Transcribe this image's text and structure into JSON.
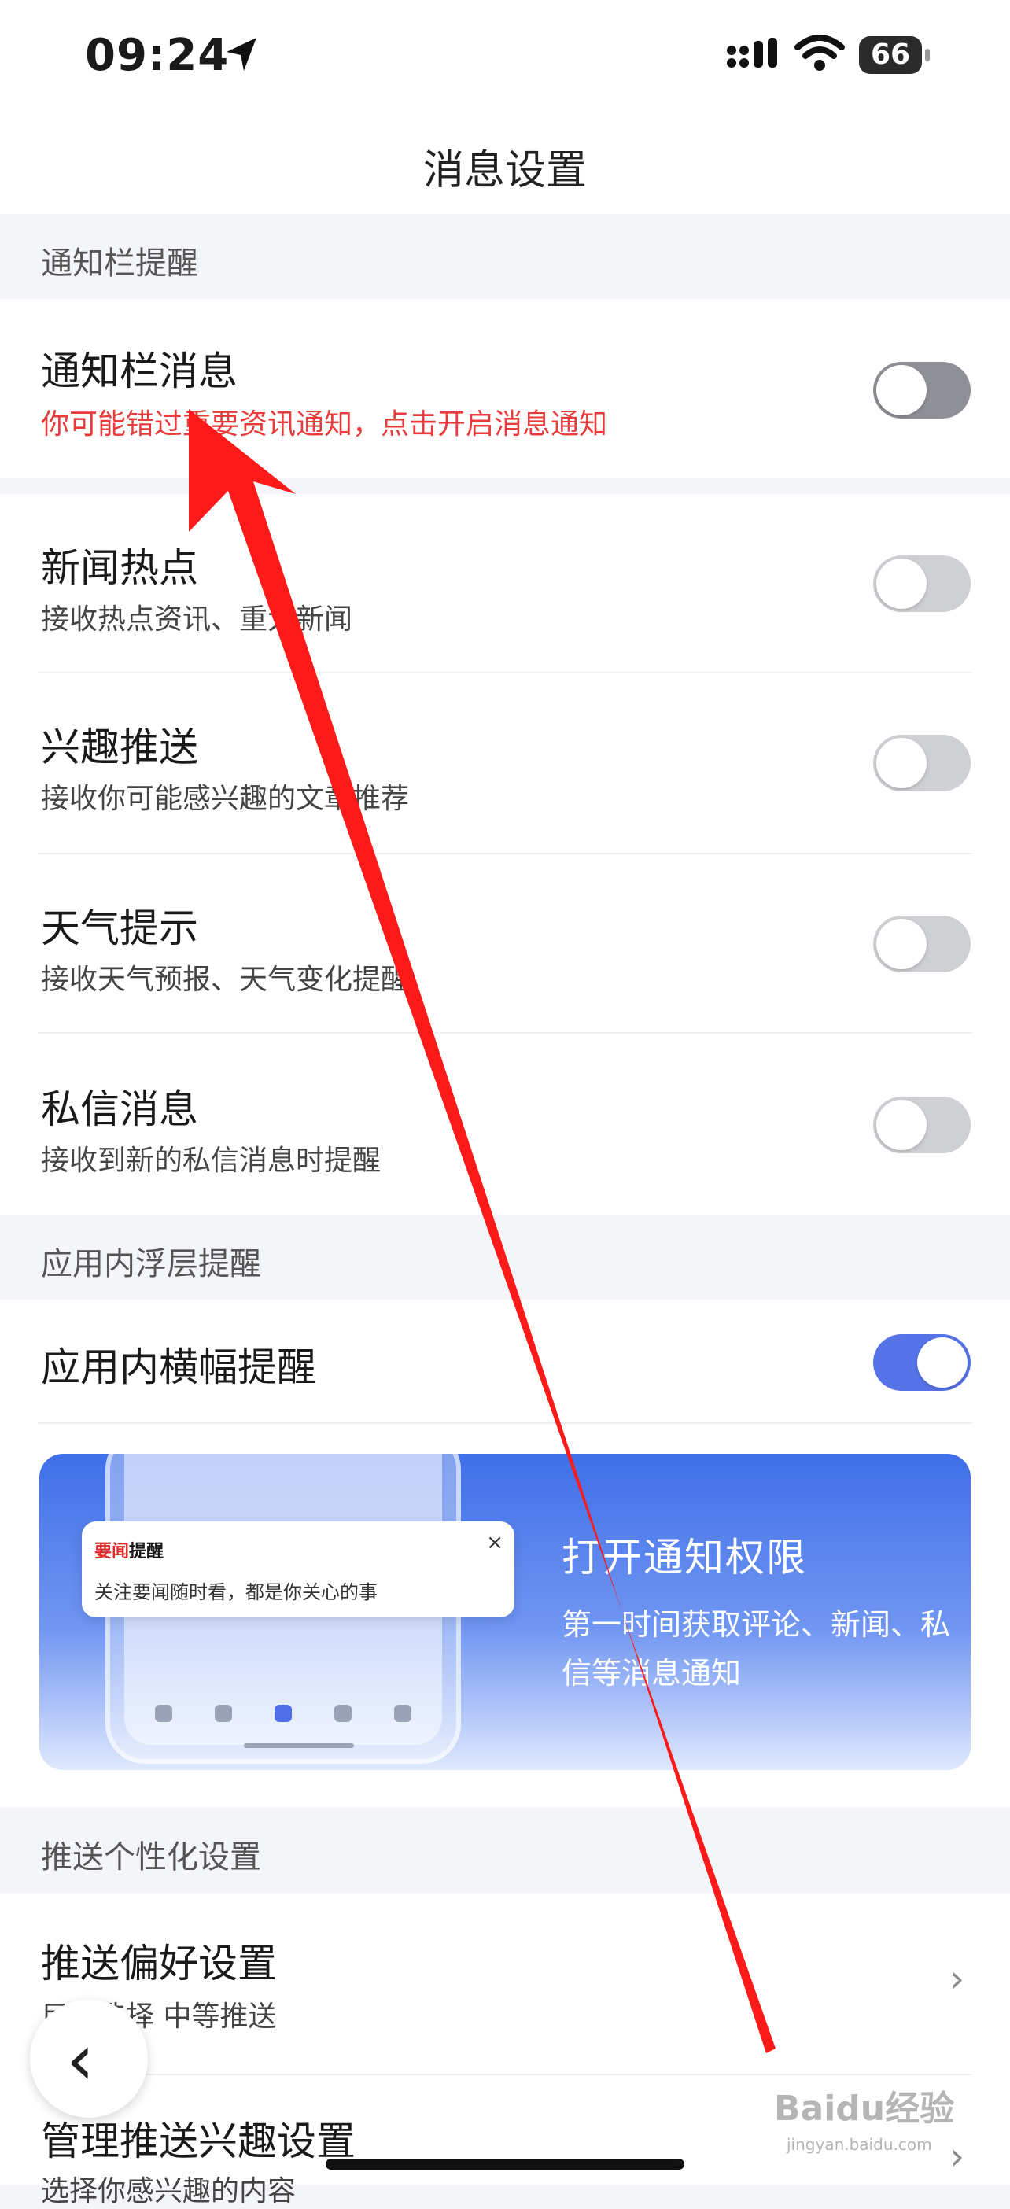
{
  "status_bar": {
    "time": "09:24",
    "battery": "66"
  },
  "nav": {
    "title": "消息设置"
  },
  "sections": {
    "notification_bar": "通知栏提醒",
    "in_app": "应用内浮层提醒",
    "personalization": "推送个性化设置"
  },
  "rows": [
    {
      "title": "通知栏消息",
      "subtitle": "你可能错过重要资讯通知，点击开启消息通知",
      "on": false
    },
    {
      "title": "新闻热点",
      "subtitle": "接收热点资讯、重大新闻",
      "on": false
    },
    {
      "title": "兴趣推送",
      "subtitle": "接收你可能感兴趣的文章推荐",
      "on": false
    },
    {
      "title": "天气提示",
      "subtitle": "接收天气预报、天气变化提醒",
      "on": false
    },
    {
      "title": "私信消息",
      "subtitle": "接收到新的私信消息时提醒",
      "on": false
    }
  ],
  "in_app_banner_row": {
    "title": "应用内横幅提醒",
    "on": true
  },
  "promo": {
    "notif_title_highlight": "要闻",
    "notif_title_rest": "提醒",
    "notif_text": "关注要闻随时看，都是你关心的事",
    "notif_close": "×",
    "title": "打开通知权限",
    "subtitle": "第一时间获取评论、新闻、私信等消息通知"
  },
  "pref_rows": [
    {
      "title": "推送偏好设置",
      "subtitle": "目前选择 中等推送"
    },
    {
      "title": "管理推送兴趣设置",
      "subtitle": "选择你感兴趣的内容"
    }
  ],
  "watermark": {
    "main": "Baidu经验",
    "sub": "jingyan.baidu.com"
  },
  "colors": {
    "accent": "#5673e8",
    "warning_red": "#e83b3b",
    "annotation_arrow": "#ff1a1a"
  }
}
